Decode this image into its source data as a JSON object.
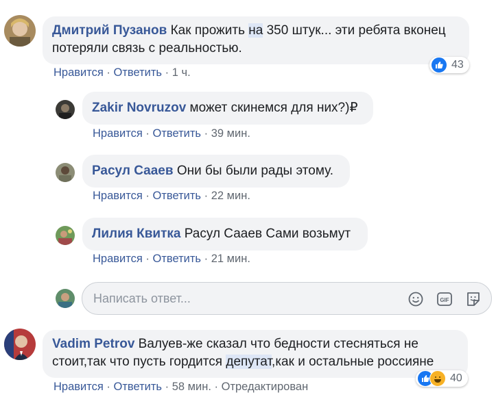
{
  "comments": [
    {
      "author": "Дмитрий Пузанов",
      "text_pre": "Как прожить ",
      "text_hl": "на",
      "text_post": " 350 штук... эти ребята вконец потеряли связь с реальностью.",
      "like": "Нравится",
      "reply": "Ответить",
      "time": "1 ч.",
      "reactions": "43"
    },
    {
      "author": "Vadim Petrov",
      "text_pre": "Валуев-же сказал что бедности стесняться не стоит,так что пусть гордится ",
      "text_hl": "депутат",
      "text_post": ",как и остальные россияне",
      "like": "Нравится",
      "reply": "Ответить",
      "time": "58 мин.",
      "edited": "Отредактирован",
      "reactions": "40"
    }
  ],
  "replies": [
    {
      "author": "Zakir Novruzov",
      "text": "может скинемся для них?)₽",
      "like": "Нравится",
      "reply": "Ответить",
      "time": "39 мин."
    },
    {
      "author": "Расул Саaев",
      "text": "Они бы были рады этому.",
      "like": "Нравится",
      "reply": "Ответить",
      "time": "22 мин."
    },
    {
      "author": "Лилия Квитка",
      "text": "Расул Саaев Сами возьмут",
      "like": "Нравится",
      "reply": "Ответить",
      "time": "21 мин."
    }
  ],
  "sep": "·",
  "reply_box": {
    "placeholder": "Написать ответ..."
  },
  "icons": [
    "emoji-icon",
    "gif-icon",
    "sticker-icon"
  ],
  "colors": {
    "link": "#385898",
    "bubble": "#f2f3f5",
    "like_blue": "#1877f2"
  }
}
